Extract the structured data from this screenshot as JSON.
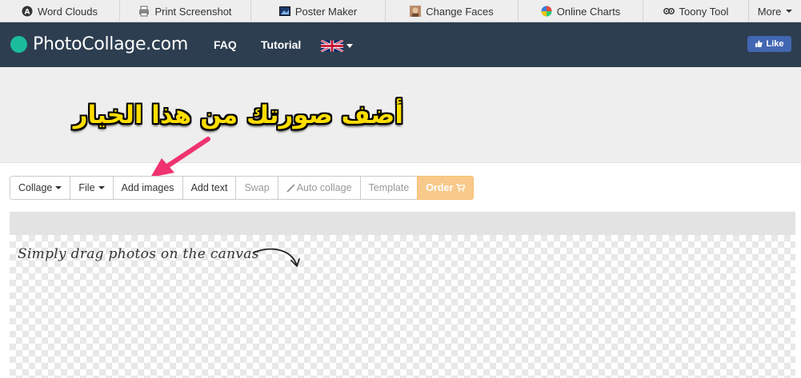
{
  "topbar": {
    "items": [
      {
        "label": "Word Clouds",
        "icon": "word-cloud-icon"
      },
      {
        "label": "Print Screenshot",
        "icon": "printer-icon"
      },
      {
        "label": "Poster Maker",
        "icon": "poster-icon"
      },
      {
        "label": "Change Faces",
        "icon": "face-icon"
      },
      {
        "label": "Online Charts",
        "icon": "pie-chart-icon"
      },
      {
        "label": "Toony Tool",
        "icon": "toony-icon"
      },
      {
        "label": "More",
        "icon": "caret-down-icon"
      }
    ]
  },
  "header": {
    "logo": "PhotoCollage.com",
    "nav": [
      {
        "label": "FAQ"
      },
      {
        "label": "Tutorial"
      }
    ],
    "language_flag": "uk-flag-icon",
    "like_label": "Like",
    "colors": {
      "bg": "#2d3e50",
      "accent": "#1abc9c"
    }
  },
  "banner": {
    "annotation": "أضف صورتك من هذا الخيار"
  },
  "toolbar": {
    "buttons": [
      {
        "label": "Collage",
        "dropdown": true
      },
      {
        "label": "File",
        "dropdown": true
      },
      {
        "label": "Add images"
      },
      {
        "label": "Add text"
      },
      {
        "label": "Swap",
        "disabled": true
      },
      {
        "label": "Auto collage",
        "disabled": true,
        "icon": "magic-wand-icon"
      },
      {
        "label": "Template",
        "disabled": true
      },
      {
        "label": "Order",
        "icon": "cart-icon",
        "color": "#f8c98a"
      }
    ]
  },
  "canvas": {
    "hint": "Simply drag photos on the canvas"
  }
}
